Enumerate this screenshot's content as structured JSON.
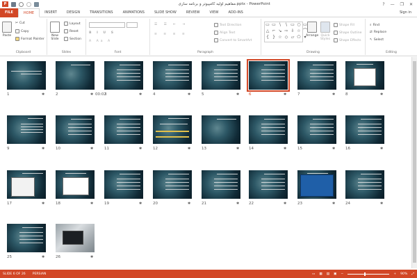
{
  "window": {
    "title": "مفاهیم اولیه کامپیوتر و برنامه سازی.pptx - PowerPoint",
    "app_icon": "P",
    "controls": [
      "?",
      "—",
      "❐",
      "✕"
    ]
  },
  "tabs": [
    {
      "label": "FILE"
    },
    {
      "label": "HOME"
    },
    {
      "label": "INSERT"
    },
    {
      "label": "DESIGN"
    },
    {
      "label": "TRANSITIONS"
    },
    {
      "label": "ANIMATIONS"
    },
    {
      "label": "SLIDE SHOW"
    },
    {
      "label": "REVIEW"
    },
    {
      "label": "VIEW"
    },
    {
      "label": "ADD-INS"
    }
  ],
  "signin": "Sign in",
  "ribbon": {
    "clipboard": {
      "label": "Clipboard",
      "paste": "Paste",
      "cut": "Cut",
      "copy": "Copy",
      "format_painter": "Format Painter"
    },
    "slides": {
      "label": "Slides",
      "new_slide": "New Slide",
      "layout": "Layout",
      "reset": "Reset",
      "section": "Section"
    },
    "font": {
      "label": "Font"
    },
    "paragraph": {
      "label": "Paragraph",
      "text_direction": "Text Direction",
      "align_text": "Align Text",
      "convert_smartart": "Convert to SmartArt"
    },
    "drawing": {
      "label": "Drawing",
      "arrange": "Arrange",
      "quick_styles": "Quick Styles",
      "shape_fill": "Shape Fill",
      "shape_outline": "Shape Outline",
      "shape_effects": "Shape Effects"
    },
    "editing": {
      "label": "Editing",
      "find": "Find",
      "replace": "Replace",
      "select": "Select"
    }
  },
  "slides": [
    {
      "number": "1",
      "extra": "",
      "selected": false,
      "kind": "title"
    },
    {
      "number": "2",
      "extra": "00:02",
      "selected": false,
      "kind": "dark"
    },
    {
      "number": "3",
      "extra": "",
      "selected": false,
      "kind": "text"
    },
    {
      "number": "4",
      "extra": "",
      "selected": false,
      "kind": "text"
    },
    {
      "number": "5",
      "extra": "",
      "selected": false,
      "kind": "text"
    },
    {
      "number": "6",
      "extra": "",
      "selected": true,
      "kind": "text"
    },
    {
      "number": "7",
      "extra": "",
      "selected": false,
      "kind": "text"
    },
    {
      "number": "8",
      "extra": "",
      "selected": false,
      "kind": "diagram"
    },
    {
      "number": "9",
      "extra": "",
      "selected": false,
      "kind": "list"
    },
    {
      "number": "10",
      "extra": "",
      "selected": false,
      "kind": "text"
    },
    {
      "number": "11",
      "extra": "",
      "selected": false,
      "kind": "text"
    },
    {
      "number": "12",
      "extra": "",
      "selected": false,
      "kind": "highlight"
    },
    {
      "number": "13",
      "extra": "",
      "selected": false,
      "kind": "dark"
    },
    {
      "number": "14",
      "extra": "",
      "selected": false,
      "kind": "text"
    },
    {
      "number": "15",
      "extra": "",
      "selected": false,
      "kind": "text"
    },
    {
      "number": "16",
      "extra": "",
      "selected": false,
      "kind": "text"
    },
    {
      "number": "17",
      "extra": "",
      "selected": false,
      "kind": "sheet"
    },
    {
      "number": "18",
      "extra": "",
      "selected": false,
      "kind": "whitebox"
    },
    {
      "number": "19",
      "extra": "",
      "selected": false,
      "kind": "text"
    },
    {
      "number": "20",
      "extra": "",
      "selected": false,
      "kind": "text"
    },
    {
      "number": "21",
      "extra": "",
      "selected": false,
      "kind": "text"
    },
    {
      "number": "22",
      "extra": "",
      "selected": false,
      "kind": "text"
    },
    {
      "number": "23",
      "extra": "",
      "selected": false,
      "kind": "bluewin"
    },
    {
      "number": "24",
      "extra": "",
      "selected": false,
      "kind": "text"
    },
    {
      "number": "25",
      "extra": "",
      "selected": false,
      "kind": "text"
    },
    {
      "number": "26",
      "extra": "",
      "selected": false,
      "kind": "photo"
    }
  ],
  "status": {
    "slide_info": "SLIDE 6 OF 26",
    "language": "PERSIAN",
    "zoom": "90%"
  },
  "colors": {
    "accent": "#d24726"
  }
}
